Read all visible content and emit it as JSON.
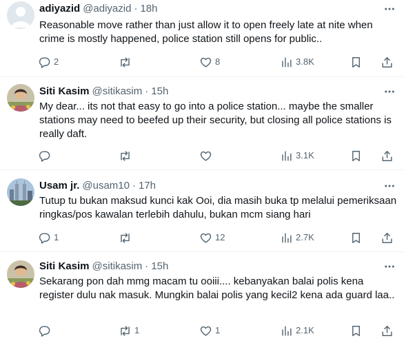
{
  "tweets": [
    {
      "name": "adiyazid",
      "handle": "@adiyazid",
      "separator": "·",
      "time": "18h",
      "text": "Reasonable move rather than just allow it to open freely late at nite when crime is mostly happened, police station still opens for public..",
      "replies": "2",
      "retweets": "",
      "likes": "8",
      "views": "3.8K",
      "avatar": "default-avatar"
    },
    {
      "name": "Siti Kasim",
      "handle": "@sitikasim",
      "separator": "·",
      "time": "15h",
      "text": "My dear... its not that easy to go into a police station... maybe the smaller stations may need to beefed up their security, but closing all police stations is really daft.",
      "replies": "",
      "retweets": "",
      "likes": "",
      "views": "3.1K",
      "avatar": "photo-avatar"
    },
    {
      "name": "Usam jr.",
      "handle": "@usam10",
      "separator": "·",
      "time": "17h",
      "text": "Tutup tu bukan maksud kunci kak Ooi, dia masih buka tp melalui pemeriksaan ringkas/pos kawalan terlebih dahulu, bukan mcm siang hari",
      "replies": "1",
      "retweets": "",
      "likes": "12",
      "views": "2.7K",
      "avatar": "city-avatar"
    },
    {
      "name": "Siti Kasim",
      "handle": "@sitikasim",
      "separator": "·",
      "time": "15h",
      "text": "Sekarang pon dah mmg macam tu ooiii.... kebanyakan balai polis kena register dulu nak masuk. Mungkin balai polis yang kecil2 kena ada guard laa..",
      "replies": "",
      "retweets": "1",
      "likes": "1",
      "views": "2.1K",
      "avatar": "photo-avatar"
    }
  ],
  "colors": {
    "text": "#0f1419",
    "secondary": "#536471",
    "divider": "#eff3f4",
    "background": "#ffffff"
  },
  "icons": {
    "more": "more-icon",
    "reply": "reply-icon",
    "retweet": "retweet-icon",
    "like": "heart-icon",
    "views": "views-icon",
    "bookmark": "bookmark-icon",
    "share": "share-icon"
  }
}
